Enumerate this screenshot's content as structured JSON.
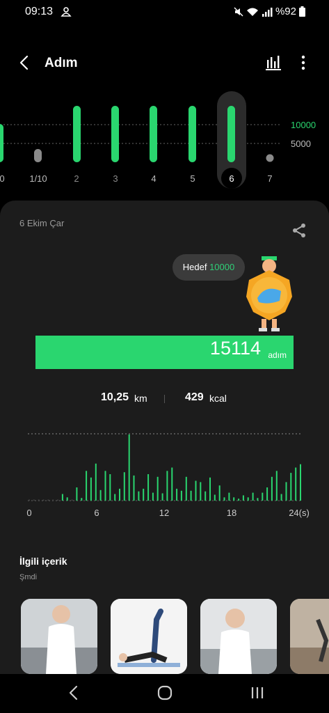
{
  "status": {
    "time": "09:13",
    "battery": "%92"
  },
  "header": {
    "title": "Adım"
  },
  "week": {
    "labels": [
      "0",
      "1/10",
      "2",
      "3",
      "4",
      "5",
      "6",
      "7"
    ],
    "selected_label": "6",
    "ref_high": "10000",
    "ref_low": "5000"
  },
  "detail": {
    "date": "6 Ekim Çar",
    "goal_label": "Hedef",
    "goal_value": "10000",
    "steps": "15114",
    "steps_unit": "adım",
    "distance": "10,25",
    "distance_unit": "km",
    "calories": "429",
    "calories_unit": "kcal"
  },
  "chart_data": {
    "type": "bar",
    "xlabel": "",
    "ylabel": "",
    "x_ticks": [
      "0",
      "6",
      "12",
      "18",
      "24(s)"
    ],
    "hourly_step_intensity_relative": [
      0,
      0,
      0,
      0,
      0,
      0,
      0,
      0.1,
      0.05,
      0,
      0.2,
      0.04,
      0.45,
      0.35,
      0.56,
      0.16,
      0.45,
      0.4,
      0.1,
      0.18,
      0.43,
      1.0,
      0.38,
      0.14,
      0.18,
      0.4,
      0.12,
      0.36,
      0.11,
      0.45,
      0.5,
      0.18,
      0.15,
      0.36,
      0.15,
      0.3,
      0.28,
      0.14,
      0.35,
      0.09,
      0.23,
      0.05,
      0.12,
      0.05,
      0.03,
      0.08,
      0.05,
      0.12,
      0.04,
      0.12,
      0.2,
      0.36,
      0.45,
      0.1,
      0.28,
      0.42,
      0.5,
      0.55
    ]
  },
  "related": {
    "title": "İlgili içerik",
    "subtitle": "Şmdi"
  }
}
